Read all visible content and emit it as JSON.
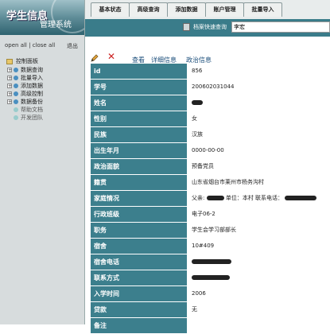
{
  "app": {
    "title_cn": "学生信息",
    "subtitle_cn": "管理系统"
  },
  "sidebar": {
    "open_all": "open all",
    "separator": "|",
    "close_all": "close all",
    "logout": "退出",
    "root": "控制面板",
    "items": [
      {
        "label": "数据查询",
        "sub": false
      },
      {
        "label": "批量导入",
        "sub": false
      },
      {
        "label": "添加数据",
        "sub": false
      },
      {
        "label": "高级控制",
        "sub": false
      },
      {
        "label": "数据备份",
        "sub": false
      },
      {
        "label": "帮助文档",
        "sub": true
      },
      {
        "label": "开发团队",
        "sub": true
      }
    ]
  },
  "tabs": [
    {
      "label": "基本状态"
    },
    {
      "label": "高级查询"
    },
    {
      "label": "添加数据"
    },
    {
      "label": "账户管理"
    },
    {
      "label": "批量导入"
    }
  ],
  "quick": {
    "label": "档案快速查询",
    "value": "李宏"
  },
  "toolbar": {
    "view": "查看",
    "detail": "详细信息",
    "politics": "政治信息"
  },
  "record": {
    "rows": [
      {
        "label": "id",
        "value": "856"
      },
      {
        "label": "学号",
        "value": "200602031044"
      },
      {
        "label": "姓名",
        "value": ""
      },
      {
        "label": "性别",
        "value": "女"
      },
      {
        "label": "民族",
        "value": "汉族"
      },
      {
        "label": "出生年月",
        "value": "0000-00-00"
      },
      {
        "label": "政治面貌",
        "value": "预备党员"
      },
      {
        "label": "籍贯",
        "value": "山东省烟台市莱州市杨务沟村"
      },
      {
        "label": "家庭情况",
        "value": "父亲:",
        "extra1": "单位：本村 联系电话："
      },
      {
        "label": "行政班级",
        "value": "电子06-2"
      },
      {
        "label": "职务",
        "value": "学生会学习部部长"
      },
      {
        "label": "宿舍",
        "value": "10#409"
      },
      {
        "label": "宿舍电话",
        "value": ""
      },
      {
        "label": "联系方式",
        "value": ""
      },
      {
        "label": "入学时间",
        "value": "2006"
      },
      {
        "label": "贷款",
        "value": "无"
      },
      {
        "label": "备注",
        "value": ""
      }
    ]
  }
}
